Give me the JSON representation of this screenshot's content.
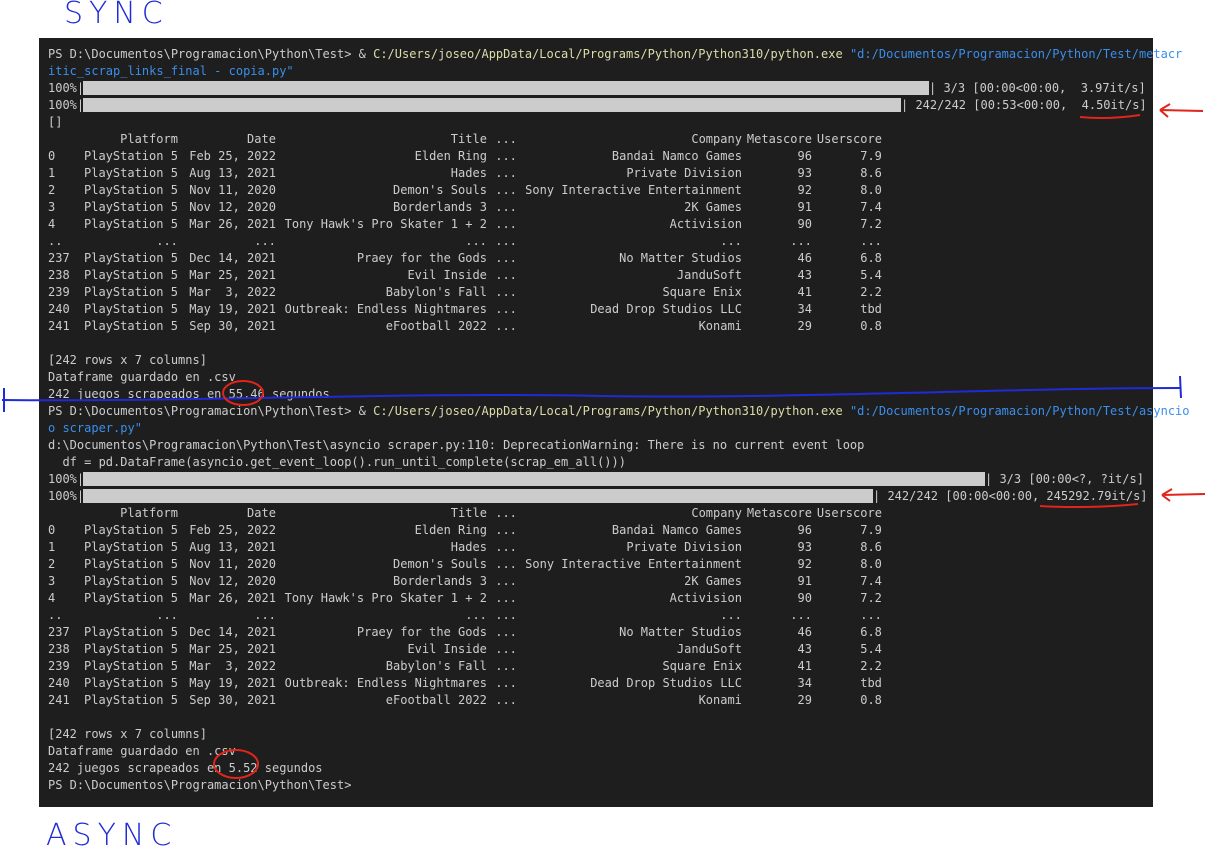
{
  "annotations": {
    "sync_label": "SYNC",
    "async_label": "ASYNC"
  },
  "colors": {
    "terminal_bg": "#1e1e1e",
    "text": "#cccccc",
    "path_yellow": "#dcdcaa",
    "string_blue": "#3b8eea",
    "annotation_blue": "#1f2bd6",
    "annotation_red": "#e0251b"
  },
  "run1": {
    "prompt": "PS D:\\Documentos\\Programacion\\Python\\Test> & ",
    "python_path": "C:/Users/joseo/AppData/Local/Programs/Python/Python310/python.exe",
    "script_part1": "\"d:/Documentos/Programacion/Python/Test/metacr",
    "script_part2": "itic_scrap_links_final - copia.py\"",
    "bar1": {
      "left": "100%|",
      "right": "| 3/3 [00:00<00:00,  3.97it/s]",
      "progress": 1.0
    },
    "bar2": {
      "left": "100%|",
      "right": "| 242/242 [00:53<00:00,  4.50it/s]",
      "progress": 1.0
    },
    "empty_list": "[]",
    "rows_summary": "[242 rows x 7 columns]",
    "saved_msg": "Dataframe guardado en .csv",
    "timing_msg": "242 juegos scrapeados en 55.46 segundos"
  },
  "run2": {
    "prompt": "PS D:\\Documentos\\Programacion\\Python\\Test> & ",
    "python_path": "C:/Users/joseo/AppData/Local/Programs/Python/Python310/python.exe",
    "script_part1": "\"d:/Documentos/Programacion/Python/Test/asyncio",
    "script_part2": "o scraper.py\"",
    "warning": "d:\\Documentos\\Programacion\\Python\\Test\\asyncio scraper.py:110: DeprecationWarning: There is no current event loop",
    "warning_code": "  df = pd.DataFrame(asyncio.get_event_loop().run_until_complete(scrap_em_all()))",
    "bar1": {
      "left": "100%|",
      "right": "| 3/3 [00:00<?, ?it/s]",
      "progress": 1.0
    },
    "bar2": {
      "left": "100%|",
      "right": "| 242/242 [00:00<00:00, 245292.79it/s]",
      "progress": 1.0
    },
    "rows_summary": "[242 rows x 7 columns]",
    "saved_msg": "Dataframe guardado en .csv",
    "timing_msg": "242 juegos scrapeados en 5.52 segundos",
    "final_prompt": "PS D:\\Documentos\\Programacion\\Python\\Test>"
  },
  "dataframe": {
    "headers": [
      "",
      "Platform",
      "Date",
      "Title",
      "...",
      "Company",
      "Metascore",
      "Userscore"
    ],
    "rows": [
      [
        "0",
        "PlayStation 5",
        "Feb 25, 2022",
        "Elden Ring",
        "...",
        "Bandai Namco Games",
        "96",
        "7.9"
      ],
      [
        "1",
        "PlayStation 5",
        "Aug 13, 2021",
        "Hades",
        "...",
        "Private Division",
        "93",
        "8.6"
      ],
      [
        "2",
        "PlayStation 5",
        "Nov 11, 2020",
        "Demon's Souls",
        "...",
        "Sony Interactive Entertainment",
        "92",
        "8.0"
      ],
      [
        "3",
        "PlayStation 5",
        "Nov 12, 2020",
        "Borderlands 3",
        "...",
        "2K Games",
        "91",
        "7.4"
      ],
      [
        "4",
        "PlayStation 5",
        "Mar 26, 2021",
        "Tony Hawk's Pro Skater 1 + 2",
        "...",
        "Activision",
        "90",
        "7.2"
      ],
      [
        "..",
        "...",
        "...",
        "...",
        "...",
        "...",
        "...",
        "..."
      ],
      [
        "237",
        "PlayStation 5",
        "Dec 14, 2021",
        "Praey for the Gods",
        "...",
        "No Matter Studios",
        "46",
        "6.8"
      ],
      [
        "238",
        "PlayStation 5",
        "Mar 25, 2021",
        "Evil Inside",
        "...",
        "JanduSoft",
        "43",
        "5.4"
      ],
      [
        "239",
        "PlayStation 5",
        "Mar  3, 2022",
        "Babylon's Fall",
        "...",
        "Square Enix",
        "41",
        "2.2"
      ],
      [
        "240",
        "PlayStation 5",
        "May 19, 2021",
        "Outbreak: Endless Nightmares",
        "...",
        "Dead Drop Studios LLC",
        "34",
        "tbd"
      ],
      [
        "241",
        "PlayStation 5",
        "Sep 30, 2021",
        "eFootball 2022",
        "...",
        "Konami",
        "29",
        "0.8"
      ]
    ]
  }
}
